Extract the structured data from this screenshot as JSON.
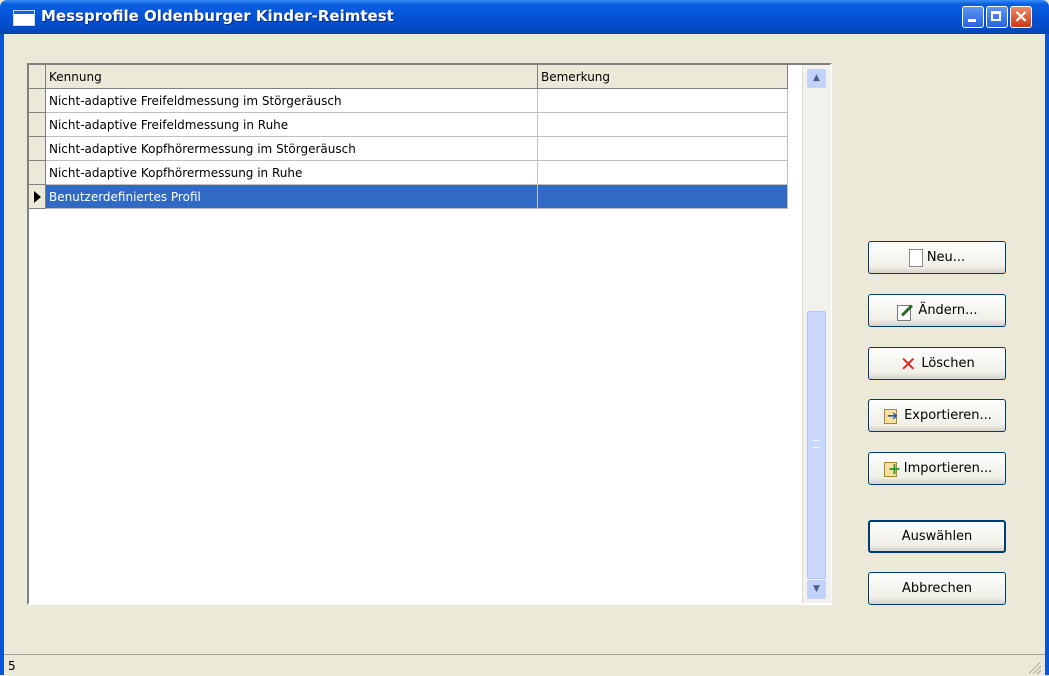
{
  "window": {
    "title": "Messprofile Oldenburger Kinder-Reimtest",
    "controls": {
      "minimize": "minimize",
      "maximize": "maximize",
      "close": "×"
    }
  },
  "grid": {
    "columns": [
      "Kennung",
      "Bemerkung"
    ],
    "rows": [
      {
        "kennung": "Nicht-adaptive Freifeldmessung im Störgeräusch",
        "bemerkung": "",
        "selected": false
      },
      {
        "kennung": "Nicht-adaptive Freifeldmessung in Ruhe",
        "bemerkung": "",
        "selected": false
      },
      {
        "kennung": "Nicht-adaptive Kopfhörermessung im Störgeräusch",
        "bemerkung": "",
        "selected": false
      },
      {
        "kennung": "Nicht-adaptive Kopfhörermessung in Ruhe",
        "bemerkung": "",
        "selected": false
      },
      {
        "kennung": "Benutzerdefiniertes Profil",
        "bemerkung": "",
        "selected": true
      }
    ],
    "selection_color": "#316ac5"
  },
  "buttons": {
    "new": "Neu...",
    "edit": "Ändern...",
    "delete": "Löschen",
    "export": "Exportieren...",
    "import": "Importieren...",
    "select": "Auswählen",
    "cancel": "Abbrechen"
  },
  "status": {
    "count": "5"
  }
}
